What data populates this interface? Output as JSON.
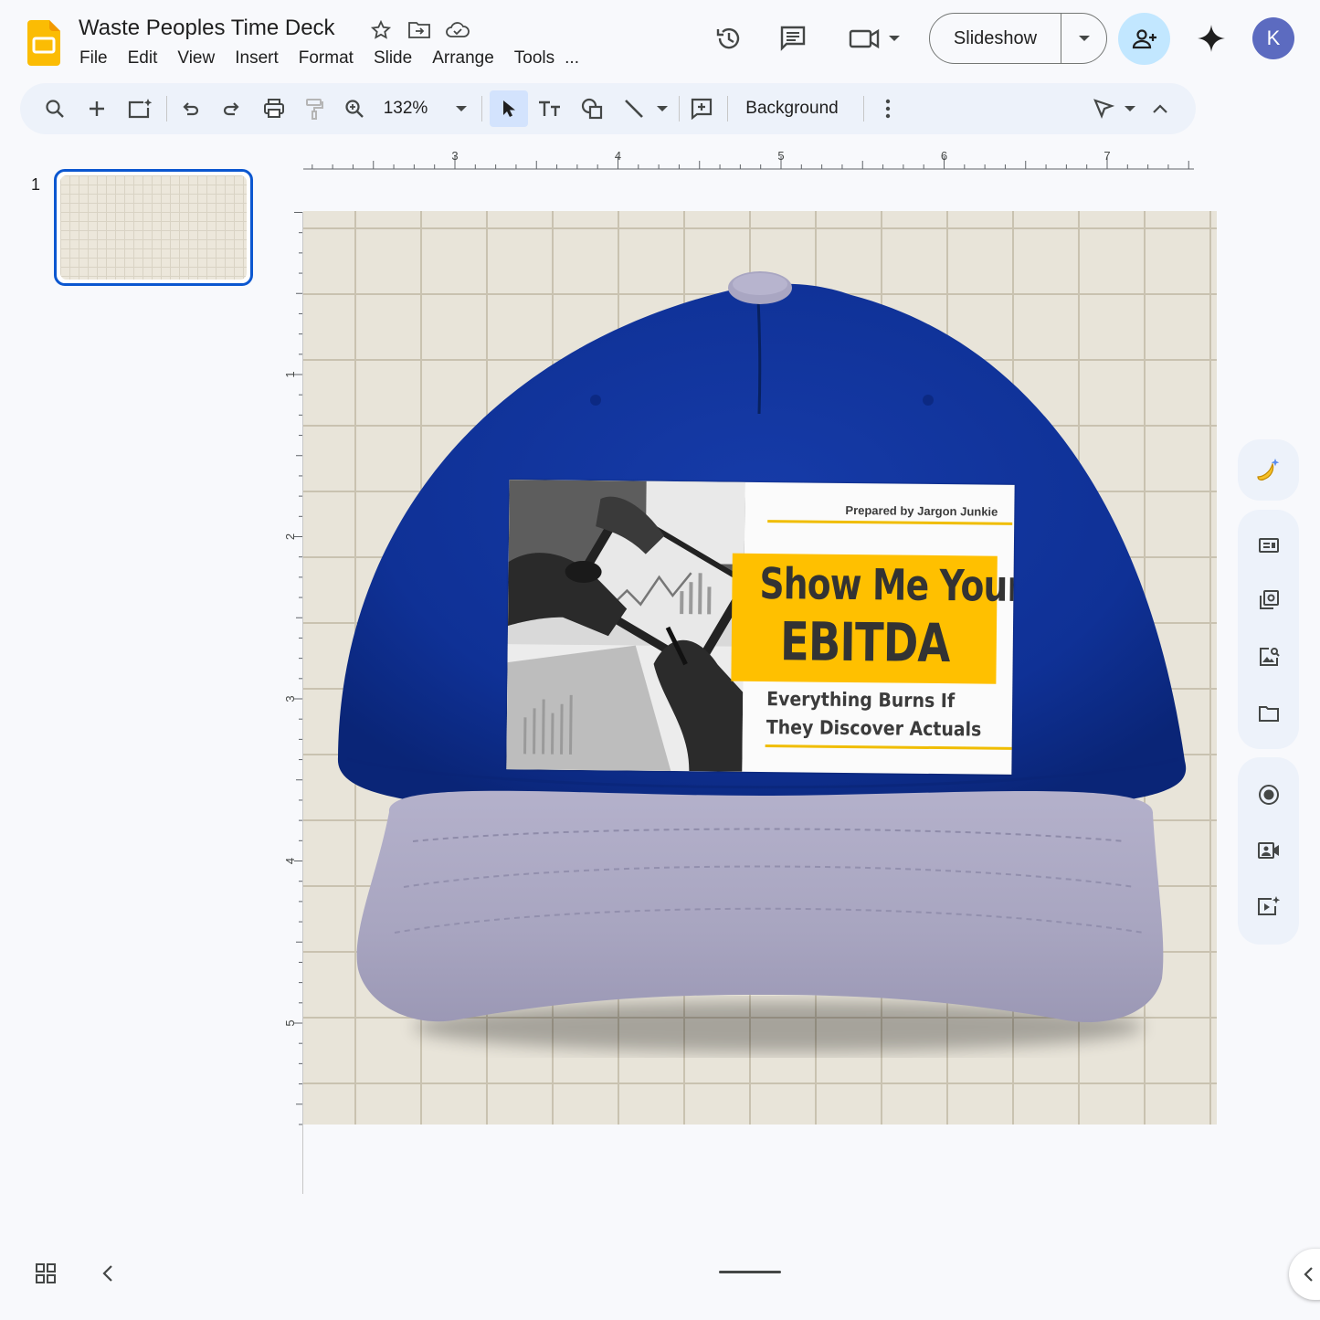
{
  "app": {
    "title": "Waste Peoples Time Deck",
    "brand_color": "#fbbc04",
    "accent_color": "#0b57d0"
  },
  "menu": [
    "File",
    "Edit",
    "View",
    "Insert",
    "Format",
    "Slide",
    "Arrange",
    "Tools",
    "..."
  ],
  "header": {
    "slideshow_label": "Slideshow",
    "avatar_initial": "K"
  },
  "toolbar": {
    "zoom": "132%",
    "background_label": "Background"
  },
  "filmstrip": {
    "slides": [
      {
        "number": "1"
      }
    ]
  },
  "ruler": {
    "horizontal": [
      "3",
      "4",
      "5",
      "6",
      "7"
    ],
    "vertical": [
      "1",
      "2",
      "3",
      "4",
      "5"
    ]
  },
  "slide": {
    "label": {
      "prepared_by": "Prepared by Jargon Junkie",
      "headline_line1": "Show Me Your",
      "headline_line2": "EBITDA",
      "subtitle_line1": "Everything Burns If",
      "subtitle_line2": "They Discover Actuals"
    },
    "colors": {
      "cap_crown": "#0f3196",
      "cap_brim": "#a7a4bf",
      "label_highlight": "#ffc000"
    }
  },
  "icons": {
    "right_panel": [
      "gemini-banana-icon",
      "text-panel-icon",
      "library-icon",
      "image-search-icon",
      "folder-icon",
      "record-icon",
      "camera-icon",
      "video-add-icon"
    ]
  }
}
